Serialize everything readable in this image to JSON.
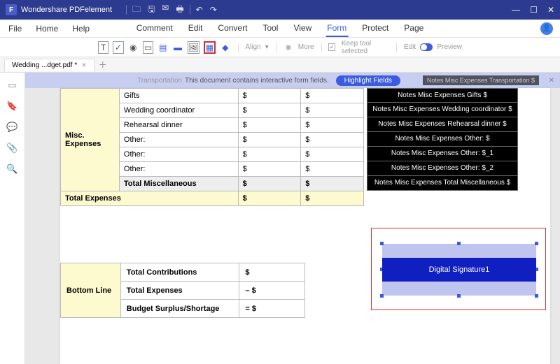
{
  "app": {
    "title": "Wondershare PDFelement"
  },
  "win": {
    "min": "—",
    "max": "☐",
    "close": "✕"
  },
  "menubar": {
    "left": [
      "File",
      "Home",
      "Help"
    ],
    "center": [
      "Comment",
      "Edit",
      "Convert",
      "Tool",
      "View",
      "Form",
      "Protect",
      "Page"
    ],
    "active_index": 5
  },
  "toolbar": {
    "align": "Align",
    "more": "More",
    "keep": "Keep tool selected",
    "edit": "Edit",
    "preview": "Preview"
  },
  "tab": {
    "name": "Wedding ...dget.pdf *"
  },
  "banner": {
    "text": "This document contains interactive form fields.",
    "btn": "Highlight Fields",
    "faded": "Transportation",
    "ghost": "Notes Misc Expenses Transportation $"
  },
  "misc": {
    "label": "Misc. Expenses",
    "rows": [
      {
        "item": "Gifts",
        "a": "$",
        "b": "$",
        "note": "Notes Misc Expenses Gifts $"
      },
      {
        "item": "Wedding coordinator",
        "a": "$",
        "b": "$",
        "note": "Notes Misc Expenses Wedding coordinator $"
      },
      {
        "item": "Rehearsal dinner",
        "a": "$",
        "b": "$",
        "note": "Notes Misc Expenses Rehearsal dinner $"
      },
      {
        "item": "Other:",
        "a": "$",
        "b": "$",
        "note": "Notes Misc Expenses Other: $"
      },
      {
        "item": "Other:",
        "a": "$",
        "b": "$",
        "note": "Notes Misc Expenses Other: $_1"
      },
      {
        "item": "Other:",
        "a": "$",
        "b": "$",
        "note": "Notes Misc Expenses Other: $_2"
      }
    ],
    "total": {
      "item": "Total Miscellaneous",
      "a": "$",
      "b": "$",
      "note": "Notes Misc Expenses Total Miscellaneous $"
    },
    "grand": {
      "item": "Total Expenses",
      "a": "$",
      "b": "$"
    }
  },
  "bottom": {
    "label": "Bottom Line",
    "rows": [
      {
        "item": "Total Contributions",
        "v": "  $"
      },
      {
        "item": "Total Expenses",
        "v": "– $"
      },
      {
        "item": "Budget Surplus/Shortage",
        "v": "= $"
      }
    ]
  },
  "signature": {
    "label": "Digital Signature1"
  }
}
